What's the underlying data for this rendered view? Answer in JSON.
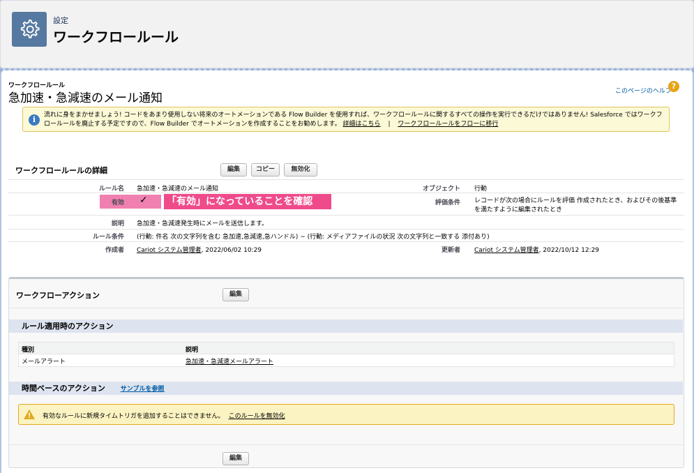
{
  "header": {
    "breadcrumb": "設定",
    "title": "ワークフロールール"
  },
  "page": {
    "crumb": "ワークフロールール",
    "title": "急加速・急減速のメール通知",
    "help_link": "このページのヘルプ",
    "help_icon_glyph": "?"
  },
  "notice": {
    "icon_glyph": "i",
    "text": "流れに身をまかせましょう! コードをあまり使用しない将来のオートメーションである Flow Builder を使用すれば、ワークフロールールに関するすべての操作を実行できるだけではありません! Salesforce ではワークフロールールを廃止する予定ですので、Flow Builder でオートメーションを作成することをお勧めします。",
    "link1": "詳細はこちら",
    "separator": "|",
    "link2": "ワークフロールールをフローに移行"
  },
  "detail": {
    "title": "ワークフロールールの詳細",
    "buttons": {
      "edit": "編集",
      "copy": "コピー",
      "deactivate": "無効化"
    },
    "rule_name_label": "ルール名",
    "rule_name_value": "急加速・急減速のメール通知",
    "object_label": "オブジェクト",
    "object_value": "行動",
    "active_label": "有効",
    "active_check": "✓",
    "annotation": "「有効」になっていることを確認",
    "eval_label": "評価条件",
    "eval_value": "レコードが次の場合にルールを評価 作成されたとき、およびその後基準を満たすように編集されたとき",
    "desc_label": "説明",
    "desc_value": "急加速・急減速発生時にメールを送信します。",
    "criteria_label": "ルール条件",
    "criteria_value": "(行動: 件名 次の文字列を含む 急加速,急減速,急ハンドル) ~ (行動: メディアファイルの状況 次の文字列と一致する 添付あり)",
    "created_label": "作成者",
    "created_user": "Cariot システム管理者",
    "created_date": ", 2022/06/02 10:29",
    "modified_label": "更新者",
    "modified_user": "Cariot システム管理者",
    "modified_date": ", 2022/10/12 12:29"
  },
  "actions": {
    "title": "ワークフローアクション",
    "edit_button": "編集",
    "immediate_title": "ルール適用時のアクション",
    "columns": [
      "種別",
      "説明"
    ],
    "rows": [
      {
        "type": "メールアラート",
        "desc": "急加速・急減速メールアラート"
      }
    ],
    "time_title": "時間ベースのアクション",
    "sample_link": "サンプルを参照",
    "warning_text": "有効なルールに新規タイムトリガを追加することはできません。",
    "warning_link": "このルールを無効化",
    "bottom_edit_button": "編集"
  },
  "colors": {
    "header_icon": "#5679a1",
    "annotation": "#ef4b8b",
    "active_highlight": "#f080b0"
  }
}
